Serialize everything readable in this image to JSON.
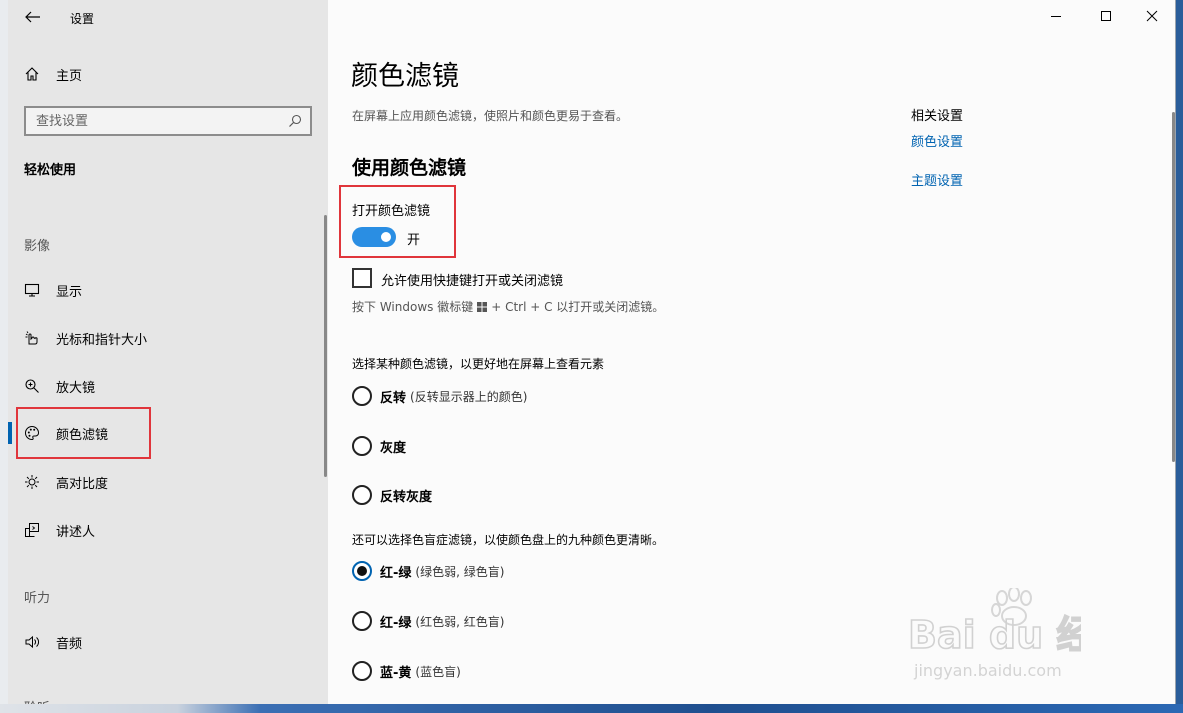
{
  "window": {
    "app_title": "设置",
    "controls": {
      "minimize": "minimize-icon",
      "maximize": "maximize-icon",
      "close": "close-icon"
    }
  },
  "sidebar": {
    "home_label": "主页",
    "search": {
      "placeholder": "查找设置",
      "value": ""
    },
    "section_title": "轻松使用",
    "groups": [
      {
        "header": "影像"
      },
      {
        "header": "听力"
      },
      {
        "header": "聆听"
      }
    ],
    "items": [
      {
        "label": "显示",
        "icon": "monitor-icon"
      },
      {
        "label": "光标和指针大小",
        "icon": "pointer-icon"
      },
      {
        "label": "放大镜",
        "icon": "magnifier-icon"
      },
      {
        "label": "颜色滤镜",
        "icon": "palette-icon",
        "active": true
      },
      {
        "label": "高对比度",
        "icon": "brightness-icon"
      },
      {
        "label": "讲述人",
        "icon": "narrator-icon"
      },
      {
        "label": "音频",
        "icon": "speaker-icon"
      }
    ]
  },
  "main": {
    "title": "颜色滤镜",
    "description": "在屏幕上应用颜色滤镜，使照片和颜色更易于查看。",
    "section_heading": "使用颜色滤镜",
    "toggle": {
      "label": "打开颜色滤镜",
      "state_text": "开",
      "on": true
    },
    "shortcut": {
      "label": "允许使用快捷键打开或关闭滤镜",
      "checked": false,
      "hint_before": "按下 Windows 徽标键",
      "hint_after": "+ Ctrl + C 以打开或关闭滤镜。"
    },
    "choose_label": "选择某种颜色滤镜，以更好地在屏幕上查看元素",
    "filters": [
      {
        "name": "反转",
        "detail": "(反转显示器上的颜色)",
        "checked": false
      },
      {
        "name": "灰度",
        "detail": "",
        "checked": false
      },
      {
        "name": "反转灰度",
        "detail": "",
        "checked": false
      }
    ],
    "colorblind_label": "还可以选择色盲症滤镜，以使颜色盘上的九种颜色更清晰。",
    "colorblind_filters": [
      {
        "name": "红-绿",
        "detail": "(绿色弱, 绿色盲)",
        "checked": true
      },
      {
        "name": "红-绿",
        "detail": "(红色弱, 红色盲)",
        "checked": false
      },
      {
        "name": "蓝-黄",
        "detail": "(蓝色盲)",
        "checked": false
      }
    ]
  },
  "related": {
    "heading": "相关设置",
    "links": [
      "颜色设置",
      "主题设置"
    ]
  },
  "watermark": {
    "brand": "Bai du 经验",
    "url": "jingyan.baidu.com"
  },
  "colors": {
    "accent": "#0063b1",
    "toggle_on": "#2a8ee3",
    "highlight": "#e0353b",
    "sidebar_bg": "#e6e6e6"
  }
}
